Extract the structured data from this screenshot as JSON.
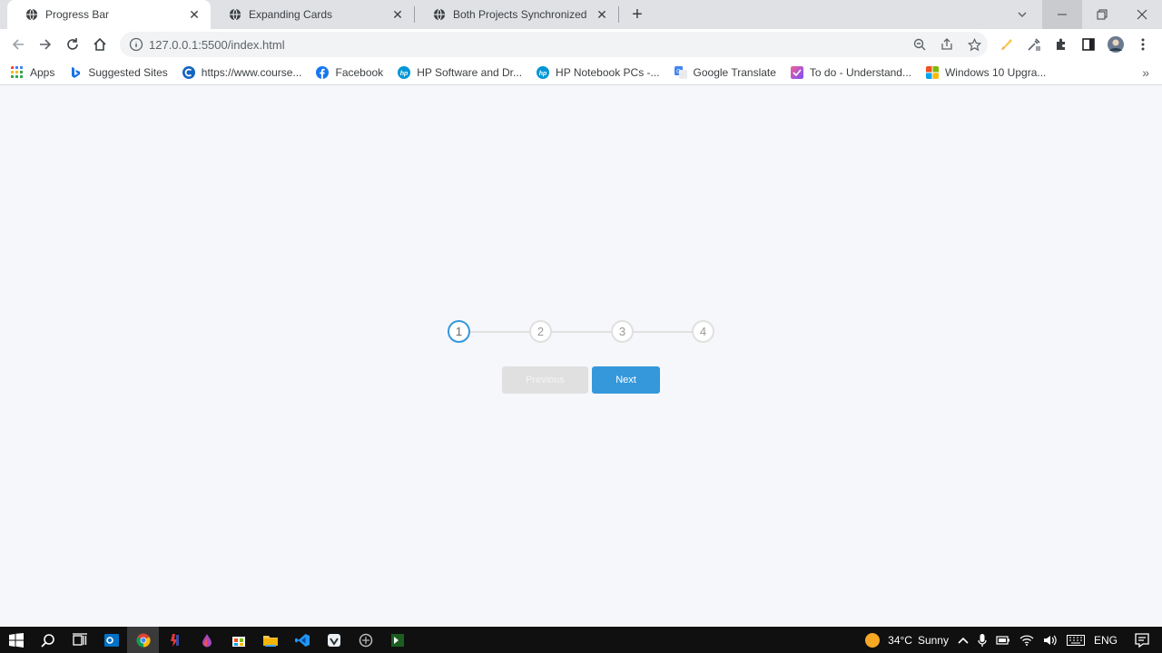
{
  "browser": {
    "tabs": [
      {
        "title": "Progress Bar",
        "active": true
      },
      {
        "title": "Expanding Cards",
        "active": false
      },
      {
        "title": "Both Projects Synchronized",
        "active": false
      }
    ],
    "url": "127.0.0.1:5500/index.html",
    "bookmarks": [
      {
        "label": "Apps",
        "icon": "apps-grid-icon",
        "color": "#4285f4"
      },
      {
        "label": "Suggested Sites",
        "icon": "bing-icon",
        "color": "#1a73e8"
      },
      {
        "label": "https://www.course...",
        "icon": "course-c-icon",
        "color": "#1565c0"
      },
      {
        "label": "Facebook",
        "icon": "facebook-icon",
        "color": "#1877f2"
      },
      {
        "label": "HP Software and Dr...",
        "icon": "hp-icon",
        "color": "#0096d6"
      },
      {
        "label": "HP Notebook PCs -...",
        "icon": "hp-icon",
        "color": "#0096d6"
      },
      {
        "label": "Google Translate",
        "icon": "google-translate-icon",
        "color": "#4285f4"
      },
      {
        "label": "To do - Understand...",
        "icon": "todo-icon",
        "color": "#e040fb"
      },
      {
        "label": "Windows 10 Upgra...",
        "icon": "windows-icon",
        "color": "#f25022"
      }
    ]
  },
  "progress": {
    "steps": [
      "1",
      "2",
      "3",
      "4"
    ],
    "active_step": 1,
    "fill_fraction": 0,
    "active_color": "#3498db",
    "inactive_color": "#e0e0e0"
  },
  "buttons": {
    "previous_label": "Previous",
    "next_label": "Next"
  },
  "taskbar": {
    "weather_temp": "34°C",
    "weather_desc": "Sunny",
    "language": "ENG"
  }
}
